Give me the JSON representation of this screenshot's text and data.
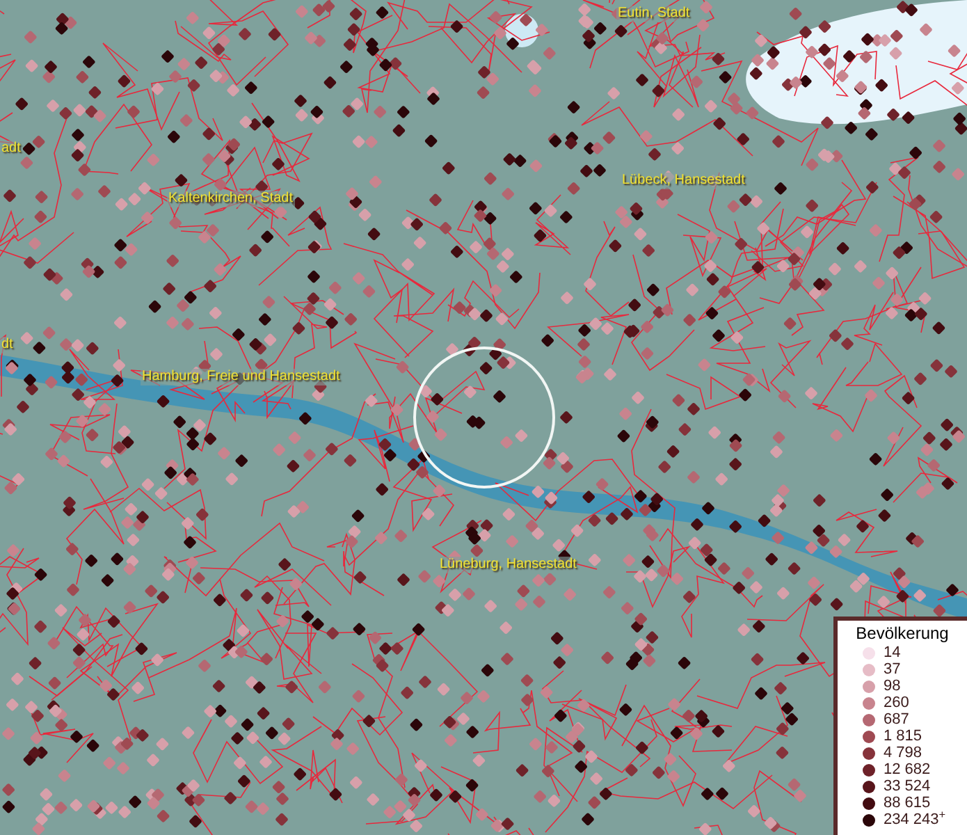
{
  "map": {
    "place_labels": [
      "Eutin, Stadt",
      "adt",
      "Kaltenkirchen, Stadt",
      "Lübeck, Hansestadt",
      "dt",
      "Hamburg, Freie und Hansestadt",
      "Lüneburg, Hansestadt"
    ]
  },
  "legend": {
    "title": "Bevölkerung",
    "items": [
      {
        "value": "14",
        "color": "#f6e0ea"
      },
      {
        "value": "37",
        "color": "#e6bcc6"
      },
      {
        "value": "98",
        "color": "#d7a0aa"
      },
      {
        "value": "260",
        "color": "#c8848e"
      },
      {
        "value": "687",
        "color": "#b56872"
      },
      {
        "value": "1 815",
        "color": "#9f4a52"
      },
      {
        "value": "4 798",
        "color": "#86333b"
      },
      {
        "value": "12 682",
        "color": "#6e2229"
      },
      {
        "value": "33 524",
        "color": "#58151b"
      },
      {
        "value": "88 615",
        "color": "#430c11"
      },
      {
        "value": "234 243$^{+}$",
        "color": "#2b0609"
      }
    ]
  }
}
